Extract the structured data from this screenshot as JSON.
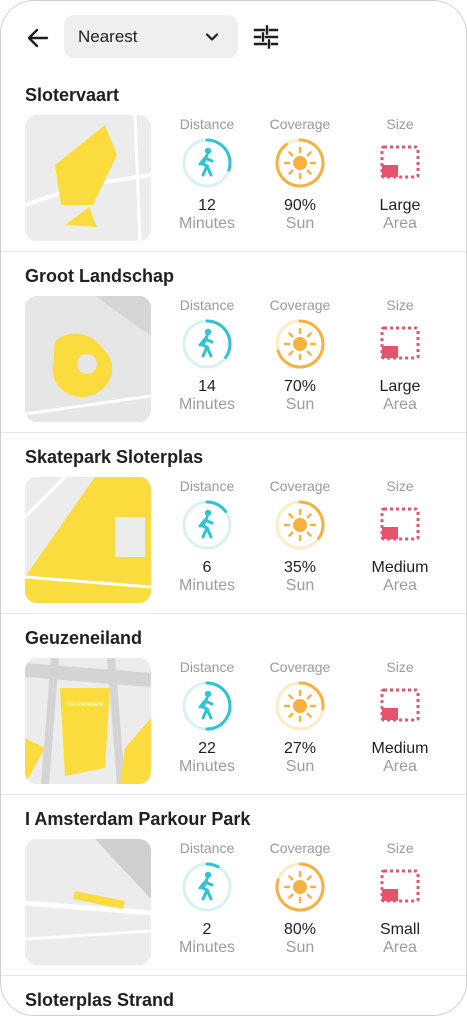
{
  "header": {
    "sort": {
      "selected": "Nearest"
    },
    "icons": {
      "back": "arrow-left-icon",
      "chevron": "chevron-down-icon",
      "filter": "sliders-icon"
    }
  },
  "metric_captions": {
    "distance": "Distance",
    "coverage": "Coverage",
    "size": "Size"
  },
  "colors": {
    "distance": "#2fc3d3",
    "coverage": "#f8b13e",
    "size": "#e4556b",
    "map_yellow": "#fbdc3f"
  },
  "places": [
    {
      "name": "Slotervaart",
      "distance_value": "12",
      "distance_unit": "Minutes",
      "distance_ring": 0.3,
      "coverage_value": "90%",
      "coverage_unit": "Sun",
      "coverage_fraction": 0.9,
      "size_value": "Large",
      "size_unit": "Area",
      "map_label": ""
    },
    {
      "name": "Groot Landschap",
      "distance_value": "14",
      "distance_unit": "Minutes",
      "distance_ring": 0.35,
      "coverage_value": "70%",
      "coverage_unit": "Sun",
      "coverage_fraction": 0.7,
      "size_value": "Large",
      "size_unit": "Area",
      "map_label": ""
    },
    {
      "name": "Skatepark Sloterplas",
      "distance_value": "6",
      "distance_unit": "Minutes",
      "distance_ring": 0.15,
      "coverage_value": "35%",
      "coverage_unit": "Sun",
      "coverage_fraction": 0.35,
      "size_value": "Medium",
      "size_unit": "Area",
      "map_label": ""
    },
    {
      "name": "Geuzeneiland",
      "distance_value": "22",
      "distance_unit": "Minutes",
      "distance_ring": 0.5,
      "coverage_value": "27%",
      "coverage_unit": "Sun",
      "coverage_fraction": 0.27,
      "size_value": "Medium",
      "size_unit": "Area",
      "map_label": "Geuzeneiland"
    },
    {
      "name": "I Amsterdam Parkour Park",
      "distance_value": "2",
      "distance_unit": "Minutes",
      "distance_ring": 0.08,
      "coverage_value": "80%",
      "coverage_unit": "Sun",
      "coverage_fraction": 0.8,
      "size_value": "Small",
      "size_unit": "Area",
      "map_label": ""
    }
  ],
  "next_place": {
    "name": "Sloterplas Strand"
  }
}
